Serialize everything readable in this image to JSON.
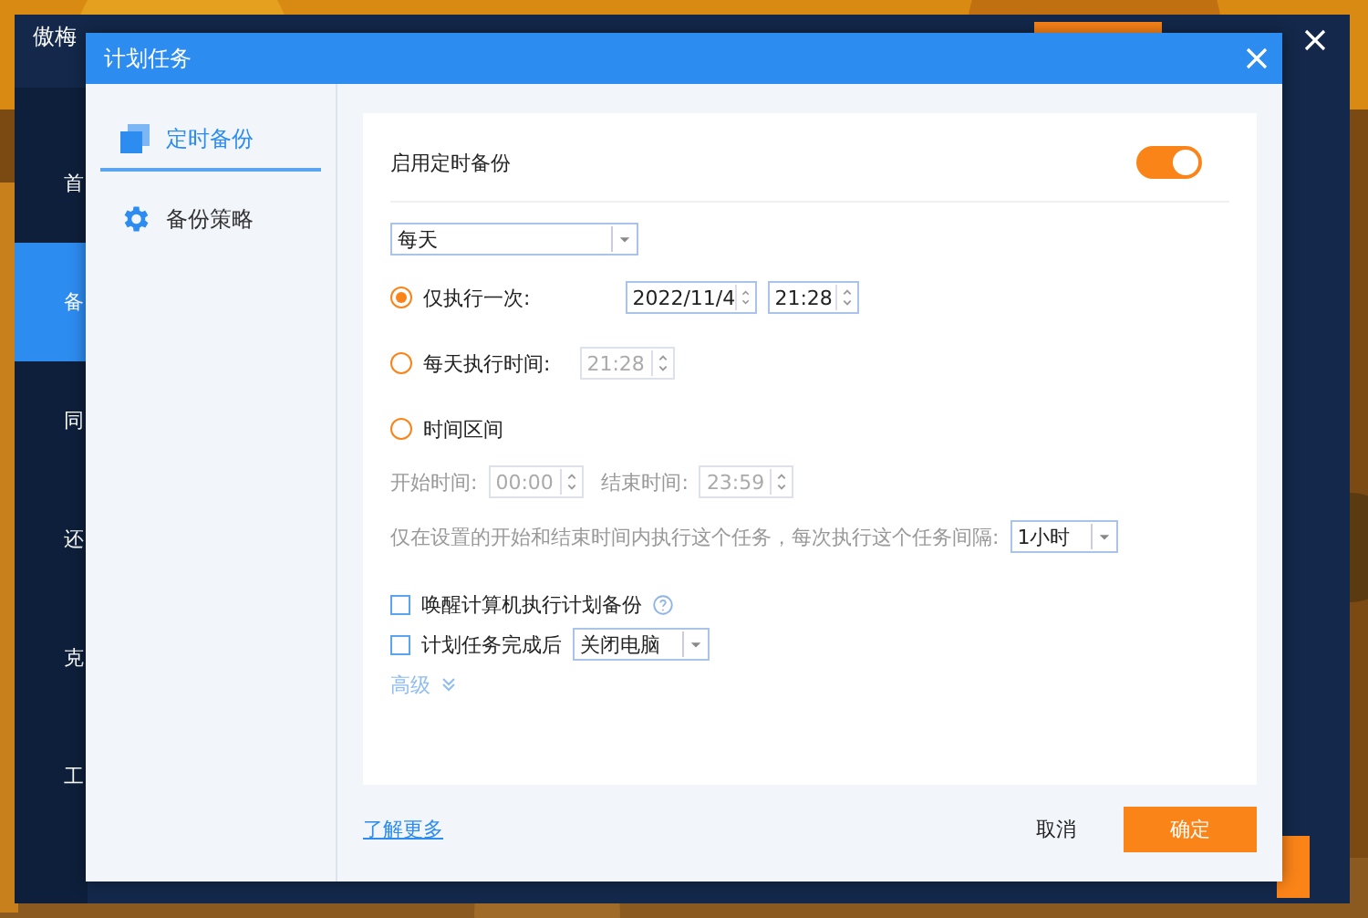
{
  "background_window": {
    "title": "傲梅",
    "sidebar_items": [
      {
        "label": "首",
        "selected": false
      },
      {
        "label": "备",
        "selected": true
      },
      {
        "label": "同",
        "selected": false
      },
      {
        "label": "还",
        "selected": false
      },
      {
        "label": "克",
        "selected": false
      },
      {
        "label": "工",
        "selected": false
      }
    ]
  },
  "dialog": {
    "title": "计划任务",
    "nav": [
      {
        "label": "定时备份",
        "selected": true
      },
      {
        "label": "备份策略",
        "selected": false
      }
    ],
    "enable": {
      "label": "启用定时备份",
      "on": true
    },
    "frequency": {
      "value": "每天"
    },
    "options": [
      {
        "kind": "datetime",
        "label": "仅执行一次:",
        "selected": true,
        "date": "2022/11/4",
        "time": "21:28"
      },
      {
        "kind": "time",
        "label": "每天执行时间:",
        "selected": false,
        "time": "21:28"
      },
      {
        "kind": "range",
        "label": "时间区间",
        "selected": false
      }
    ],
    "range": {
      "start_label": "开始时间:",
      "start": "00:00",
      "end_label": "结束时间:",
      "end": "23:59",
      "note": "仅在设置的开始和结束时间内执行这个任务，每次执行这个任务间隔:",
      "interval": "1小时"
    },
    "wake": {
      "label": "唤醒计算机执行计划备份",
      "checked": false
    },
    "after": {
      "label": "计划任务完成后",
      "checked": false,
      "action": "关闭电脑"
    },
    "advanced": "高级",
    "learn_more": "了解更多",
    "buttons": {
      "cancel": "取消",
      "ok": "确定"
    }
  }
}
